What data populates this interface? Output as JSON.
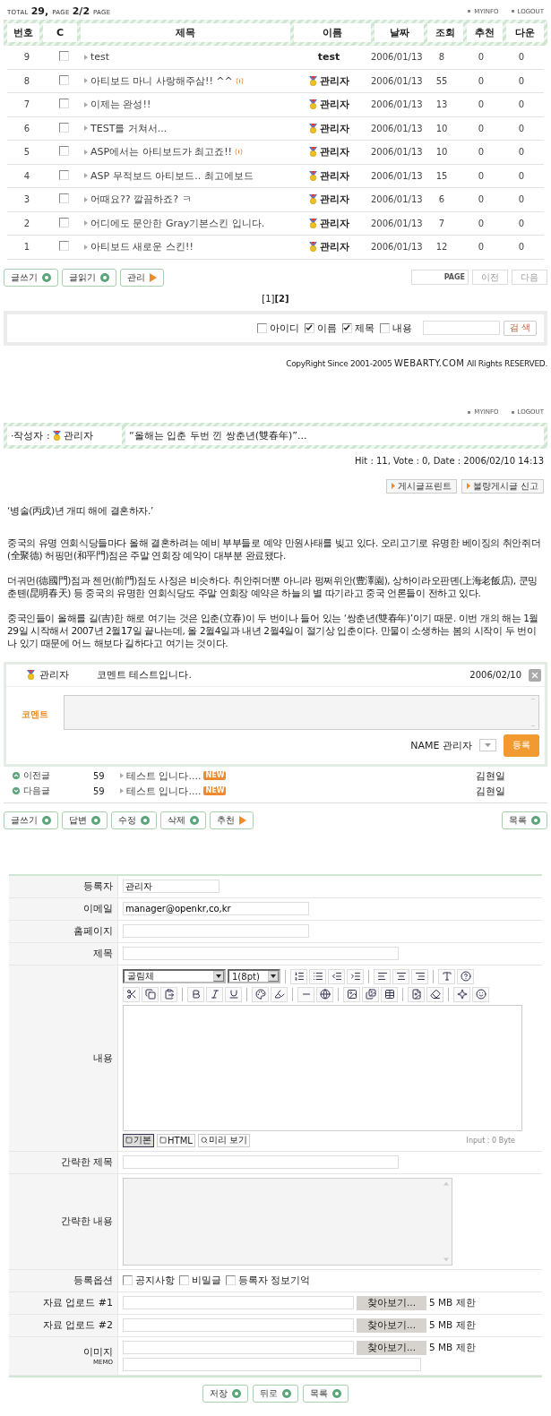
{
  "top": {
    "total_label": "TOTAL",
    "total": "29,",
    "page_label": "PAGE",
    "page": "2/2",
    "page_suffix": "PAGE",
    "links": [
      "MYINFO",
      "LOGOUT"
    ]
  },
  "list": {
    "columns": [
      "번호",
      "C",
      "제목",
      "이름",
      "날짜",
      "조회",
      "추천",
      "다운"
    ],
    "rows": [
      {
        "no": "9",
        "checked": false,
        "title": "test",
        "has_comments": false,
        "name": "test",
        "admin": false,
        "date": "2006/01/13",
        "views": "8",
        "votes": "0",
        "downloads": "0"
      },
      {
        "no": "8",
        "checked": false,
        "title": "아티보드 마니 사랑해주삼!! ^^",
        "has_comments": true,
        "name": "관리자",
        "admin": true,
        "date": "2006/01/13",
        "views": "55",
        "votes": "0",
        "downloads": "0"
      },
      {
        "no": "7",
        "checked": false,
        "title": "이제는 완성!!",
        "has_comments": false,
        "name": "관리자",
        "admin": true,
        "date": "2006/01/13",
        "views": "13",
        "votes": "0",
        "downloads": "0"
      },
      {
        "no": "6",
        "checked": false,
        "title": "TEST를 거쳐서...",
        "has_comments": false,
        "name": "관리자",
        "admin": true,
        "date": "2006/01/13",
        "views": "10",
        "votes": "0",
        "downloads": "0"
      },
      {
        "no": "5",
        "checked": false,
        "title": "ASP에서는 아티보드가 최고죠!!",
        "has_comments": true,
        "name": "관리자",
        "admin": true,
        "date": "2006/01/13",
        "views": "10",
        "votes": "0",
        "downloads": "0"
      },
      {
        "no": "4",
        "checked": false,
        "title": "ASP 무적보드 아티보드.. 최고에보드",
        "has_comments": false,
        "name": "관리자",
        "admin": true,
        "date": "2006/01/13",
        "views": "15",
        "votes": "0",
        "downloads": "0"
      },
      {
        "no": "3",
        "checked": false,
        "title": "어때요?? 깔끔하죠? ㅋ",
        "has_comments": false,
        "name": "관리자",
        "admin": true,
        "date": "2006/01/13",
        "views": "6",
        "votes": "0",
        "downloads": "0"
      },
      {
        "no": "2",
        "checked": false,
        "title": "어디에도 문안한 Gray기본스킨 입니다.",
        "has_comments": false,
        "name": "관리자",
        "admin": true,
        "date": "2006/01/13",
        "views": "7",
        "votes": "0",
        "downloads": "0"
      },
      {
        "no": "1",
        "checked": false,
        "title": "아티보드 새로운 스킨!!",
        "has_comments": false,
        "name": "관리자",
        "admin": true,
        "date": "2006/01/13",
        "views": "12",
        "votes": "0",
        "downloads": "0"
      }
    ]
  },
  "list_buttons": [
    {
      "label": "글쓰기",
      "kind": "circle"
    },
    {
      "label": "글읽기",
      "kind": "circle"
    },
    {
      "label": "관리",
      "kind": "arrow"
    }
  ],
  "page_nav": {
    "field_label": "PAGE",
    "buttons": [
      "이전",
      "다음"
    ]
  },
  "pages": [
    {
      "label": "[1]",
      "selected": false
    },
    {
      "label": "[2]",
      "selected": true
    }
  ],
  "search": {
    "options": [
      {
        "label": "아이디",
        "checked": false
      },
      {
        "label": "이름",
        "checked": true
      },
      {
        "label": "제목",
        "checked": true
      },
      {
        "label": "내용",
        "checked": false
      }
    ],
    "button": "검 색"
  },
  "copyright": {
    "prefix": "CopyRight Since 2001-2005",
    "brand": "WEBARTY.COM",
    "suffix": "All Rights RESERVED."
  },
  "view": {
    "links": [
      "MYINFO",
      "LOGOUT"
    ],
    "author_label": "·작성자 :",
    "author": "관리자",
    "title": "“올해는 입춘 두번 낀 쌍춘년(雙春年)”...",
    "meta": "Hit : 11, Vote : 0, Date : 2006/02/10 14:13",
    "actions": [
      "게시글프린트",
      "불량게시글 신고"
    ],
    "paragraphs": [
      "‘병술(丙戌)년 개띠 해에 결혼하자.’",
      "중국의 유명 연회식당들마다 올해 결혼하려는 예비 부부들로 예약 만원사태를 빚고 있다. 오리고기로 유명한 베이징의 취안쥐더(全聚德) 허핑먼(和平門)점은 주말 연회장 예약이 대부분 완료됐다.",
      "더궈먼(德國門)점과 첸먼(前門)점도 사정은 비슷하다. 취안쥐더뿐 아니라 펑쩌위안(豊澤園), 상하이라오판뎬(上海老飯店), 쿤밍춘톈(昆明春天) 등 중국의 유명한 연회식당도 주말 연회장 예약은 하늘의 별 따기라고 중국 언론들이 전하고 있다.",
      "중국인들이 올해를 길(吉)한 해로 여기는 것은 입춘(立春)이 두 번이나 들어 있는 ‘쌍춘년(雙春年)’이기 때문. 이번 개의 해는 1월29일 시작해서 2007년 2월17일 끝나는데, 올 2월4일과 내년 2월4일이 절기상 입춘이다. 만물이 소생하는 봄의 시작이 두 번이나 있기 때문에 어느 해보다 길하다고 여기는 것이다."
    ]
  },
  "comment": {
    "author": "관리자",
    "text": "코멘트 테스트입니다.",
    "date": "2006/02/10",
    "label": "코멘트",
    "name_label": "NAME 관리자",
    "submit": "등록"
  },
  "neighbors": [
    {
      "label": "이전글",
      "kind": "prev",
      "no": "59",
      "title": "테스트 입니다....",
      "is_new": true,
      "badge": "NEW",
      "author": "김현일"
    },
    {
      "label": "다음글",
      "kind": "next",
      "no": "59",
      "title": "테스트 입니다....",
      "is_new": true,
      "badge": "NEW",
      "author": "김현일"
    }
  ],
  "view_buttons": [
    {
      "label": "글쓰기",
      "kind": "circle"
    },
    {
      "label": "답변",
      "kind": "circle"
    },
    {
      "label": "수정",
      "kind": "circle"
    },
    {
      "label": "삭제",
      "kind": "circle"
    },
    {
      "label": "추천",
      "kind": "arrow"
    }
  ],
  "list_link": {
    "label": "목록",
    "kind": "circle"
  },
  "form": {
    "rows": [
      {
        "label": "등록자",
        "kind": "short",
        "value": "관리자"
      },
      {
        "label": "이메일",
        "kind": "medium",
        "value": "manager@openkr,co,kr"
      },
      {
        "label": "홈페이지",
        "kind": "medium"
      },
      {
        "label": "제목",
        "kind": "long"
      },
      {
        "label": "내용",
        "kind": "editor",
        "font": "굴림체",
        "font_size": "1(8pt)",
        "modes": [
          {
            "label": "기본",
            "selected": true
          },
          {
            "label": "HTML",
            "selected": false
          },
          {
            "label": "미리 보기",
            "selected": false
          }
        ],
        "counter": "Input : 0 Byte"
      },
      {
        "label": "간략한 제목",
        "kind": "long"
      },
      {
        "label": "간략한 내용",
        "kind": "textarea"
      },
      {
        "label": "등록옵션",
        "kind": "options",
        "options": [
          {
            "label": "공지사항",
            "checked": false
          },
          {
            "label": "비밀글",
            "checked": false
          },
          {
            "label": "등록자 정보기억",
            "checked": false
          }
        ]
      },
      {
        "label": "자료 업로드 #1",
        "kind": "upload",
        "browse": "찾아보기...",
        "limit": "5 MB 제한"
      },
      {
        "label": "자료 업로드 #2",
        "kind": "upload",
        "browse": "찾아보기...",
        "limit": "5 MB 제한"
      },
      {
        "label": "이미지",
        "sublabel": "MEMO",
        "kind": "image",
        "browse": "찾아보기...",
        "limit": "5 MB 제한"
      }
    ],
    "buttons": [
      {
        "label": "저장",
        "kind": "circle"
      },
      {
        "label": "뒤로",
        "kind": "circle"
      },
      {
        "label": "목록",
        "kind": "circle"
      }
    ]
  }
}
